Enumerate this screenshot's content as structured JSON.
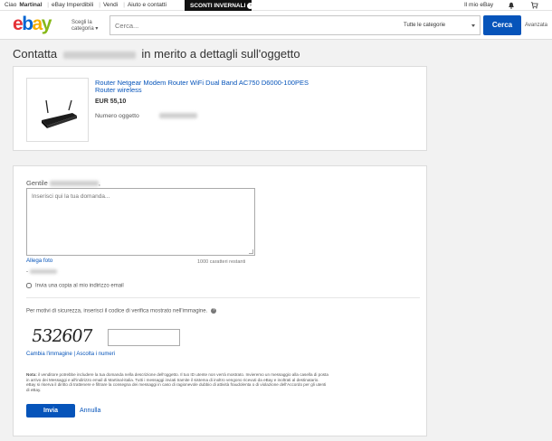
{
  "topbar": {
    "greeting": "Ciao",
    "username": "Martinal",
    "links": [
      "eBay Imperdibili",
      "Vendi",
      "Aiuto e contatti"
    ],
    "promo": "SCONTI INVERNALI",
    "my_ebay": "Il mio eBay"
  },
  "header": {
    "logo": {
      "e": "e",
      "b": "b",
      "a": "a",
      "y": "y"
    },
    "category_label": "Scegli la categoria",
    "search_placeholder": "Cerca...",
    "category_select": "Tutte le categorie",
    "search_button": "Cerca",
    "advanced": "Avanzata"
  },
  "page": {
    "title_prefix": "Contatta",
    "title_suffix": "in merito a dettagli sull'oggetto"
  },
  "item": {
    "title": "Router Netgear Modem Router WiFi Dual Band AC750 D6000-100PES Router wireless",
    "price": "EUR 55,10",
    "number_label": "Numero oggetto"
  },
  "form": {
    "greeting": "Gentile",
    "comma": ",",
    "textarea_placeholder": "Inserisci qui la tua domanda...",
    "attach": "Allega foto",
    "chars_left": "1000 caratteri restanti",
    "dash": "-",
    "copy_label": "Invia una copia al mio indirizzo email",
    "security_text": "Per motivi di sicurezza, inserisci il codice di verifica mostrato nell'immagine.",
    "captcha_code": "532607",
    "change_image": "Cambia l'immagine",
    "listen": "Ascolta i numeri",
    "note_label": "Nota:",
    "note_text": "il venditore potrebbe includere la tua domanda nella descrizione dell'oggetto. Il tuo ID utente non verrà mostrato. Invieremo un messaggio alla casella di posta in arrivo dei Messaggi e all'indirizzo email di Martinal-italia. Tutti i messaggi inviati tramite il sistema di inoltro vengono ricevuti da eBay e inoltrati al destinatario. eBay si riserva il diritto di trattenere e filtrare la consegna dei messaggi in caso di ragionevole dubbio di attività fraudolenta o di violazione dell'Accordo per gli utenti di eBay.",
    "submit": "Invia",
    "cancel": "Annulla"
  },
  "colors": {
    "accent": "#0654ba",
    "link": "#0654ba",
    "promo_bg": "#111111"
  }
}
